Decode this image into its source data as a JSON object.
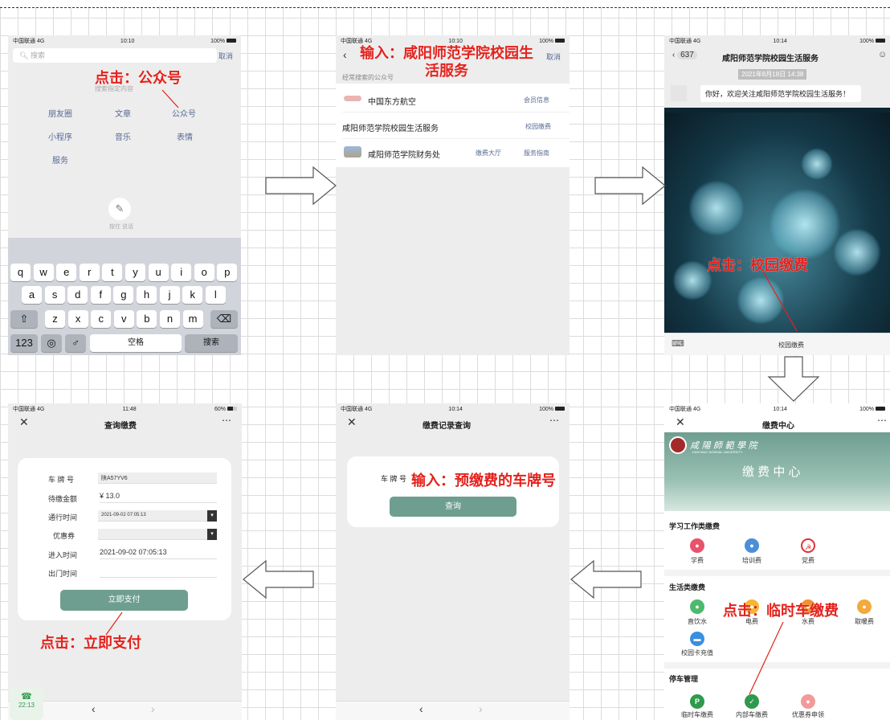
{
  "p1": {
    "status": {
      "carrier": "中国联通 4G",
      "time": "10:10",
      "battery": "100%"
    },
    "search_placeholder": "搜索",
    "cancel": "取消",
    "hint": "搜索指定内容",
    "cats": [
      "朋友圈",
      "文章",
      "公众号",
      "小程序",
      "音乐",
      "表情",
      "服务"
    ],
    "voice": "按住 说话",
    "keys_row1": [
      "q",
      "w",
      "e",
      "r",
      "t",
      "y",
      "u",
      "i",
      "o",
      "p"
    ],
    "keys_row2": [
      "a",
      "s",
      "d",
      "f",
      "g",
      "h",
      "j",
      "k",
      "l"
    ],
    "keys_row3": [
      "z",
      "x",
      "c",
      "v",
      "b",
      "n",
      "m"
    ],
    "key_123": "123",
    "key_space": "空格",
    "key_search": "搜索"
  },
  "p2": {
    "status": {
      "carrier": "中国联通 4G",
      "time": "10:10",
      "battery": "100%"
    },
    "cancel": "取消",
    "section": "经常搜索的公众号",
    "r1": {
      "name": "中国东方航空",
      "link": "会员信息"
    },
    "r2": {
      "name": "咸阳师范学院校园生活服务",
      "link": "校园缴费"
    },
    "r3": {
      "name": "咸阳师范学院财务处",
      "link1": "缴费大厅",
      "link2": "服务指南"
    }
  },
  "p3": {
    "status": {
      "carrier": "中国联通 4G",
      "time": "10:14",
      "battery": "100%"
    },
    "back_count": "637",
    "title": "咸阳师范学院校园生活服务",
    "date": "2021年8月18日 14:38",
    "msg": "你好，欢迎关注咸阳师范学院校园生活服务！",
    "menu": "校园缴费"
  },
  "p4": {
    "status": {
      "carrier": "中国联通 4G",
      "time": "10:14",
      "battery": "100%"
    },
    "title": "缴费中心",
    "brand": "咸 陽 師 範 學 院",
    "brand_en": "XIANYANG NORMAL UNIVERSITY",
    "banner": "缴 费 中 心",
    "sec1": "学习工作类缴费",
    "sec1_items": [
      "学费",
      "培训费",
      "党费"
    ],
    "sec2": "生活类缴费",
    "sec2_items": [
      "直饮水",
      "电费",
      "水费",
      "取暖费",
      "校园卡充值"
    ],
    "sec3": "停车管理",
    "sec3_items": [
      "临时车缴费",
      "内部车缴费",
      "优惠券申领"
    ]
  },
  "p5": {
    "status": {
      "carrier": "中国联通 4G",
      "time": "10:14",
      "battery": "100%"
    },
    "title": "缴费记录查询",
    "plate_label": "车 牌 号",
    "query": "查询"
  },
  "p6": {
    "status": {
      "carrier": "中国联通 4G",
      "time": "11:48",
      "battery": "60%"
    },
    "title": "查询缴费",
    "fields": [
      {
        "label": "车 牌 号",
        "value": "陕A57YV6"
      },
      {
        "label": "待缴金额",
        "value": "¥ 13.0"
      },
      {
        "label": "通行时间",
        "value": "2021-09-02 07:05:13"
      },
      {
        "label": "优惠券",
        "value": ""
      },
      {
        "label": "进入时间",
        "value": "2021-09-02 07:05:13"
      },
      {
        "label": "出门时间",
        "value": ""
      }
    ],
    "pay": "立即支付",
    "dock_time": "22:13"
  },
  "annotations": {
    "a1": "点击：公众号",
    "a2": "输入：咸阳师范学院校园生活服务",
    "a3": "点击：校园缴费",
    "a4": "点击：临时车缴费",
    "a5": "输入：预缴费的车牌号",
    "a6": "点击：立即支付"
  }
}
